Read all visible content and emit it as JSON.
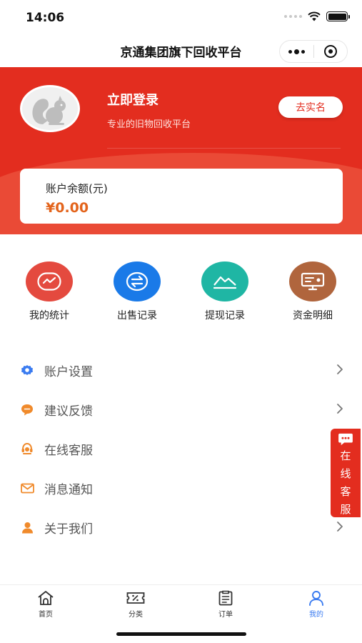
{
  "status": {
    "time": "14:06"
  },
  "nav": {
    "title": "京通集团旗下回收平台",
    "more_icon": "more-icon",
    "close_icon": "close-circle-icon"
  },
  "profile": {
    "login": "立即登录",
    "subtitle": "专业的旧物回收平台",
    "verify_button": "去实名",
    "avatar_icon": "squirrel-avatar-icon",
    "balance_label": "账户余额(元)",
    "balance_value": "¥0.00"
  },
  "grid": [
    {
      "label": "我的统计",
      "icon": "chart-icon",
      "color": "#e44a3f"
    },
    {
      "label": "出售记录",
      "icon": "exchange-icon",
      "color": "#1a7ae8"
    },
    {
      "label": "提现记录",
      "icon": "mountain-icon",
      "color": "#1fb6a4"
    },
    {
      "label": "资金明细",
      "icon": "monitor-icon",
      "color": "#b0653d"
    }
  ],
  "menu": [
    {
      "label": "账户设置",
      "icon": "gear-icon",
      "color": "#3a7bf0",
      "chevron": true
    },
    {
      "label": "建议反馈",
      "icon": "chat-bubble-icon",
      "color": "#f08a2b",
      "chevron": true
    },
    {
      "label": "在线客服",
      "icon": "headset-icon",
      "color": "#f08a2b",
      "chevron": false
    },
    {
      "label": "消息通知",
      "icon": "envelope-icon",
      "color": "#f08a2b",
      "chevron": false
    },
    {
      "label": "关于我们",
      "icon": "person-icon",
      "color": "#f08a2b",
      "chevron": true
    }
  ],
  "float_service": {
    "label": [
      "在",
      "线",
      "客",
      "服"
    ],
    "icon": "chat-dots-icon"
  },
  "tabbar": [
    {
      "label": "首页",
      "icon": "home-icon",
      "active": false
    },
    {
      "label": "分类",
      "icon": "ticket-icon",
      "active": false
    },
    {
      "label": "订单",
      "icon": "clipboard-icon",
      "active": false
    },
    {
      "label": "我的",
      "icon": "user-icon",
      "active": true
    }
  ],
  "colors": {
    "brand_red": "#e32d1f",
    "active_blue": "#3a7bf0",
    "amount_orange": "#e3641c"
  }
}
